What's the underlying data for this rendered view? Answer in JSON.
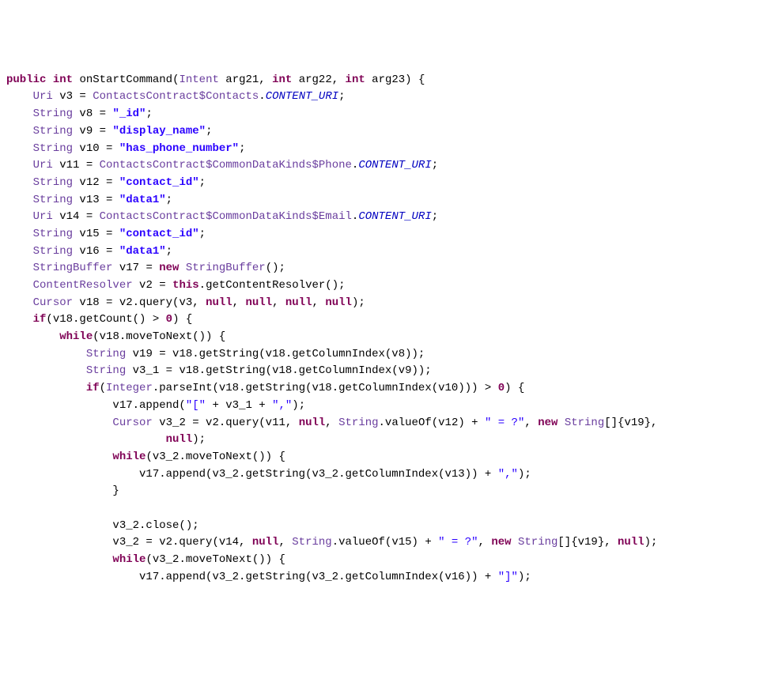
{
  "code": {
    "lines": [
      {
        "indent": 0,
        "tokens": [
          {
            "t": "kw",
            "v": "public"
          },
          {
            "t": "id",
            "v": " "
          },
          {
            "t": "kw",
            "v": "int"
          },
          {
            "t": "id",
            "v": " onStartCommand("
          },
          {
            "t": "type",
            "v": "Intent"
          },
          {
            "t": "id",
            "v": " arg21, "
          },
          {
            "t": "kw",
            "v": "int"
          },
          {
            "t": "id",
            "v": " arg22, "
          },
          {
            "t": "kw",
            "v": "int"
          },
          {
            "t": "id",
            "v": " arg23) {"
          }
        ]
      },
      {
        "indent": 1,
        "tokens": [
          {
            "t": "type",
            "v": "Uri"
          },
          {
            "t": "id",
            "v": " v3 = "
          },
          {
            "t": "cls",
            "v": "ContactsContract$Contacts"
          },
          {
            "t": "id",
            "v": "."
          },
          {
            "t": "stat",
            "v": "CONTENT_URI"
          },
          {
            "t": "id",
            "v": ";"
          }
        ]
      },
      {
        "indent": 1,
        "tokens": [
          {
            "t": "type",
            "v": "String"
          },
          {
            "t": "id",
            "v": " v8 = "
          },
          {
            "t": "str",
            "v": "\"_id\""
          },
          {
            "t": "id",
            "v": ";"
          }
        ]
      },
      {
        "indent": 1,
        "tokens": [
          {
            "t": "type",
            "v": "String"
          },
          {
            "t": "id",
            "v": " v9 = "
          },
          {
            "t": "str",
            "v": "\"display_name\""
          },
          {
            "t": "id",
            "v": ";"
          }
        ]
      },
      {
        "indent": 1,
        "tokens": [
          {
            "t": "type",
            "v": "String"
          },
          {
            "t": "id",
            "v": " v10 = "
          },
          {
            "t": "str",
            "v": "\"has_phone_number\""
          },
          {
            "t": "id",
            "v": ";"
          }
        ]
      },
      {
        "indent": 1,
        "tokens": [
          {
            "t": "type",
            "v": "Uri"
          },
          {
            "t": "id",
            "v": " v11 = "
          },
          {
            "t": "cls",
            "v": "ContactsContract$CommonDataKinds$Phone"
          },
          {
            "t": "id",
            "v": "."
          },
          {
            "t": "stat",
            "v": "CONTENT_URI"
          },
          {
            "t": "id",
            "v": ";"
          }
        ]
      },
      {
        "indent": 1,
        "tokens": [
          {
            "t": "type",
            "v": "String"
          },
          {
            "t": "id",
            "v": " v12 = "
          },
          {
            "t": "str",
            "v": "\"contact_id\""
          },
          {
            "t": "id",
            "v": ";"
          }
        ]
      },
      {
        "indent": 1,
        "tokens": [
          {
            "t": "type",
            "v": "String"
          },
          {
            "t": "id",
            "v": " v13 = "
          },
          {
            "t": "str",
            "v": "\"data1\""
          },
          {
            "t": "id",
            "v": ";"
          }
        ]
      },
      {
        "indent": 1,
        "tokens": [
          {
            "t": "type",
            "v": "Uri"
          },
          {
            "t": "id",
            "v": " v14 = "
          },
          {
            "t": "cls",
            "v": "ContactsContract$CommonDataKinds$Email"
          },
          {
            "t": "id",
            "v": "."
          },
          {
            "t": "stat",
            "v": "CONTENT_URI"
          },
          {
            "t": "id",
            "v": ";"
          }
        ]
      },
      {
        "indent": 1,
        "tokens": [
          {
            "t": "type",
            "v": "String"
          },
          {
            "t": "id",
            "v": " v15 = "
          },
          {
            "t": "str",
            "v": "\"contact_id\""
          },
          {
            "t": "id",
            "v": ";"
          }
        ]
      },
      {
        "indent": 1,
        "tokens": [
          {
            "t": "type",
            "v": "String"
          },
          {
            "t": "id",
            "v": " v16 = "
          },
          {
            "t": "str",
            "v": "\"data1\""
          },
          {
            "t": "id",
            "v": ";"
          }
        ]
      },
      {
        "indent": 1,
        "tokens": [
          {
            "t": "type",
            "v": "StringBuffer"
          },
          {
            "t": "id",
            "v": " v17 = "
          },
          {
            "t": "kw",
            "v": "new"
          },
          {
            "t": "id",
            "v": " "
          },
          {
            "t": "type",
            "v": "StringBuffer"
          },
          {
            "t": "id",
            "v": "();"
          }
        ]
      },
      {
        "indent": 1,
        "tokens": [
          {
            "t": "type",
            "v": "ContentResolver"
          },
          {
            "t": "id",
            "v": " v2 = "
          },
          {
            "t": "kw",
            "v": "this"
          },
          {
            "t": "id",
            "v": ".getContentResolver();"
          }
        ]
      },
      {
        "indent": 1,
        "tokens": [
          {
            "t": "type",
            "v": "Cursor"
          },
          {
            "t": "id",
            "v": " v18 = v2.query(v3, "
          },
          {
            "t": "kw",
            "v": "null"
          },
          {
            "t": "id",
            "v": ", "
          },
          {
            "t": "kw",
            "v": "null"
          },
          {
            "t": "id",
            "v": ", "
          },
          {
            "t": "kw",
            "v": "null"
          },
          {
            "t": "id",
            "v": ", "
          },
          {
            "t": "kw",
            "v": "null"
          },
          {
            "t": "id",
            "v": ");"
          }
        ]
      },
      {
        "indent": 1,
        "tokens": [
          {
            "t": "kw",
            "v": "if"
          },
          {
            "t": "id",
            "v": "(v18.getCount() > "
          },
          {
            "t": "num",
            "v": "0"
          },
          {
            "t": "id",
            "v": ") {"
          }
        ]
      },
      {
        "indent": 2,
        "tokens": [
          {
            "t": "kw",
            "v": "while"
          },
          {
            "t": "id",
            "v": "(v18.moveToNext()) {"
          }
        ]
      },
      {
        "indent": 3,
        "tokens": [
          {
            "t": "type",
            "v": "String"
          },
          {
            "t": "id",
            "v": " v19 = v18.getString(v18.getColumnIndex(v8));"
          }
        ]
      },
      {
        "indent": 3,
        "tokens": [
          {
            "t": "type",
            "v": "String"
          },
          {
            "t": "id",
            "v": " v3_1 = v18.getString(v18.getColumnIndex(v9));"
          }
        ]
      },
      {
        "indent": 3,
        "tokens": [
          {
            "t": "kw",
            "v": "if"
          },
          {
            "t": "id",
            "v": "("
          },
          {
            "t": "type",
            "v": "Integer"
          },
          {
            "t": "id",
            "v": ".parseInt(v18.getString(v18.getColumnIndex(v10))) > "
          },
          {
            "t": "num",
            "v": "0"
          },
          {
            "t": "id",
            "v": ") {"
          }
        ]
      },
      {
        "indent": 4,
        "tokens": [
          {
            "t": "id",
            "v": "v17.append("
          },
          {
            "t": "strp",
            "v": "\"[\""
          },
          {
            "t": "id",
            "v": " + v3_1 + "
          },
          {
            "t": "strp",
            "v": "\",\""
          },
          {
            "t": "id",
            "v": ");"
          }
        ]
      },
      {
        "indent": 4,
        "tokens": [
          {
            "t": "type",
            "v": "Cursor"
          },
          {
            "t": "id",
            "v": " v3_2 = v2.query(v11, "
          },
          {
            "t": "kw",
            "v": "null"
          },
          {
            "t": "id",
            "v": ", "
          },
          {
            "t": "type",
            "v": "String"
          },
          {
            "t": "id",
            "v": ".valueOf(v12) + "
          },
          {
            "t": "strp",
            "v": "\" = ?\""
          },
          {
            "t": "id",
            "v": ", "
          },
          {
            "t": "kw",
            "v": "new"
          },
          {
            "t": "id",
            "v": " "
          },
          {
            "t": "type",
            "v": "String"
          },
          {
            "t": "id",
            "v": "[]{v19},"
          }
        ]
      },
      {
        "indent": 6,
        "tokens": [
          {
            "t": "kw",
            "v": "null"
          },
          {
            "t": "id",
            "v": ");"
          }
        ]
      },
      {
        "indent": 4,
        "tokens": [
          {
            "t": "kw",
            "v": "while"
          },
          {
            "t": "id",
            "v": "(v3_2.moveToNext()) {"
          }
        ]
      },
      {
        "indent": 5,
        "tokens": [
          {
            "t": "id",
            "v": "v17.append(v3_2.getString(v3_2.getColumnIndex(v13)) + "
          },
          {
            "t": "strp",
            "v": "\",\""
          },
          {
            "t": "id",
            "v": ");"
          }
        ]
      },
      {
        "indent": 4,
        "tokens": [
          {
            "t": "id",
            "v": "}"
          }
        ]
      },
      {
        "indent": 4,
        "tokens": [
          {
            "t": "id",
            "v": ""
          }
        ]
      },
      {
        "indent": 4,
        "tokens": [
          {
            "t": "id",
            "v": "v3_2.close();"
          }
        ]
      },
      {
        "indent": 4,
        "tokens": [
          {
            "t": "id",
            "v": "v3_2 = v2.query(v14, "
          },
          {
            "t": "kw",
            "v": "null"
          },
          {
            "t": "id",
            "v": ", "
          },
          {
            "t": "type",
            "v": "String"
          },
          {
            "t": "id",
            "v": ".valueOf(v15) + "
          },
          {
            "t": "strp",
            "v": "\" = ?\""
          },
          {
            "t": "id",
            "v": ", "
          },
          {
            "t": "kw",
            "v": "new"
          },
          {
            "t": "id",
            "v": " "
          },
          {
            "t": "type",
            "v": "String"
          },
          {
            "t": "id",
            "v": "[]{v19}, "
          },
          {
            "t": "kw",
            "v": "null"
          },
          {
            "t": "id",
            "v": ");"
          }
        ]
      },
      {
        "indent": 4,
        "tokens": [
          {
            "t": "kw",
            "v": "while"
          },
          {
            "t": "id",
            "v": "(v3_2.moveToNext()) {"
          }
        ]
      },
      {
        "indent": 5,
        "tokens": [
          {
            "t": "id",
            "v": "v17.append(v3_2.getString(v3_2.getColumnIndex(v16)) + "
          },
          {
            "t": "strp",
            "v": "\"]\""
          },
          {
            "t": "id",
            "v": ");"
          }
        ]
      }
    ]
  },
  "indent_unit": "    "
}
